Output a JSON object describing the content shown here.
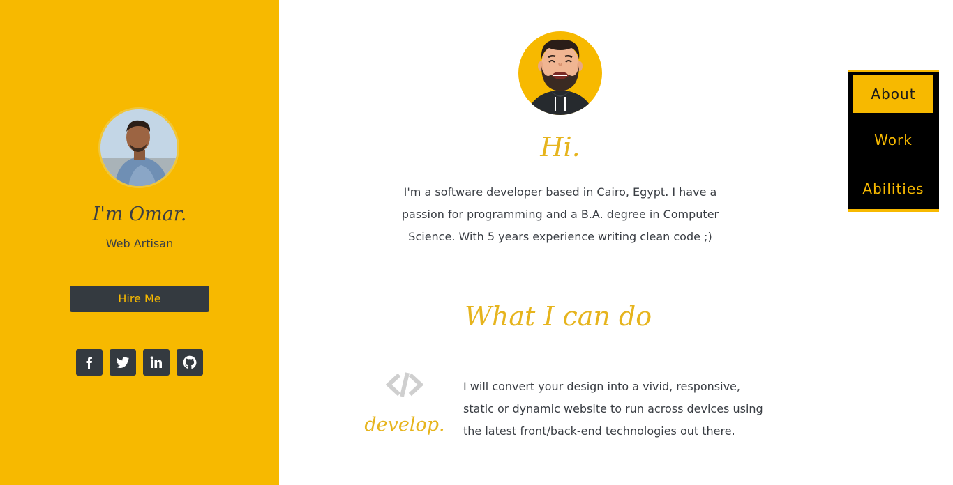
{
  "colors": {
    "accent": "#f7b900",
    "dark": "#343a40",
    "text": "#3a3e44",
    "heading": "#e6b41d"
  },
  "sidebar": {
    "name": "I'm Omar.",
    "role": "Web Artisan",
    "hire_label": "Hire Me",
    "socials": [
      "facebook-icon",
      "twitter-icon",
      "linkedin-icon",
      "github-icon"
    ]
  },
  "main": {
    "greeting": "Hi.",
    "about": "I'm a software developer based in Cairo, Egypt. I have a passion for programming and a B.A. degree in Computer Science. With 5 years experience writing clean code ;)",
    "skills_title": "What I can do",
    "skill": {
      "icon": "code-icon",
      "name": "develop.",
      "description": "I will convert your design into a vivid, responsive, static or dynamic website to run across devices using the latest front/back-end technologies out there."
    }
  },
  "nav": {
    "items": [
      {
        "label": "About",
        "active": true
      },
      {
        "label": "Work",
        "active": false
      },
      {
        "label": "Abilities",
        "active": false
      }
    ]
  }
}
